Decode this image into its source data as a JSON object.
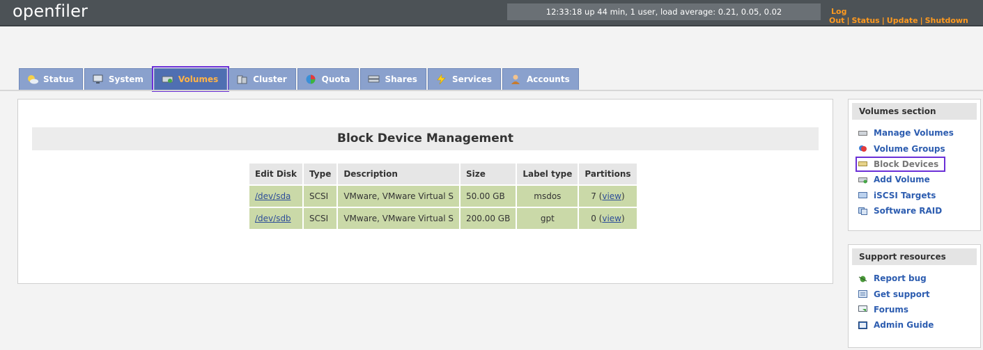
{
  "header": {
    "logo": "openfiler",
    "uptime": "12:33:18 up 44 min, 1 user, load average: 0.21, 0.05, 0.02",
    "links": [
      "Log Out",
      "Status",
      "Update",
      "Shutdown"
    ]
  },
  "tabs": [
    {
      "label": "Status",
      "icon": "status-icon"
    },
    {
      "label": "System",
      "icon": "system-icon"
    },
    {
      "label": "Volumes",
      "icon": "volumes-icon",
      "active": true
    },
    {
      "label": "Cluster",
      "icon": "cluster-icon"
    },
    {
      "label": "Quota",
      "icon": "quota-icon"
    },
    {
      "label": "Shares",
      "icon": "shares-icon"
    },
    {
      "label": "Services",
      "icon": "services-icon"
    },
    {
      "label": "Accounts",
      "icon": "accounts-icon"
    }
  ],
  "main": {
    "title": "Block Device Management",
    "table": {
      "headers": [
        "Edit Disk",
        "Type",
        "Description",
        "Size",
        "Label type",
        "Partitions"
      ],
      "rows": [
        {
          "disk": "/dev/sda",
          "type": "SCSI",
          "description": "VMware, VMware Virtual S",
          "size": "50.00 GB",
          "label_type": "msdos",
          "partitions": "7",
          "view": "view"
        },
        {
          "disk": "/dev/sdb",
          "type": "SCSI",
          "description": "VMware, VMware Virtual S",
          "size": "200.00 GB",
          "label_type": "gpt",
          "partitions": "0",
          "view": "view"
        }
      ]
    }
  },
  "sidebar": {
    "volumes_section": {
      "title": "Volumes section",
      "items": [
        {
          "label": "Manage Volumes",
          "icon": "manage-volumes-icon"
        },
        {
          "label": "Volume Groups",
          "icon": "volume-groups-icon"
        },
        {
          "label": "Block Devices",
          "icon": "block-devices-icon",
          "current": true
        },
        {
          "label": "Add Volume",
          "icon": "add-volume-icon"
        },
        {
          "label": "iSCSI Targets",
          "icon": "iscsi-targets-icon"
        },
        {
          "label": "Software RAID",
          "icon": "software-raid-icon"
        }
      ]
    },
    "support": {
      "title": "Support resources",
      "items": [
        {
          "label": "Report bug",
          "icon": "bug-icon"
        },
        {
          "label": "Get support",
          "icon": "support-icon"
        },
        {
          "label": "Forums",
          "icon": "forums-icon"
        },
        {
          "label": "Admin Guide",
          "icon": "guide-icon"
        }
      ]
    }
  },
  "colors": {
    "header_bg": "#4c5256",
    "tab_bg": "#8aa1cd",
    "tab_active_bg": "#4f6fb2",
    "link_orange": "#ff9a1f",
    "row_green": "#cad9a8",
    "sidebar_link": "#2d5db0"
  }
}
